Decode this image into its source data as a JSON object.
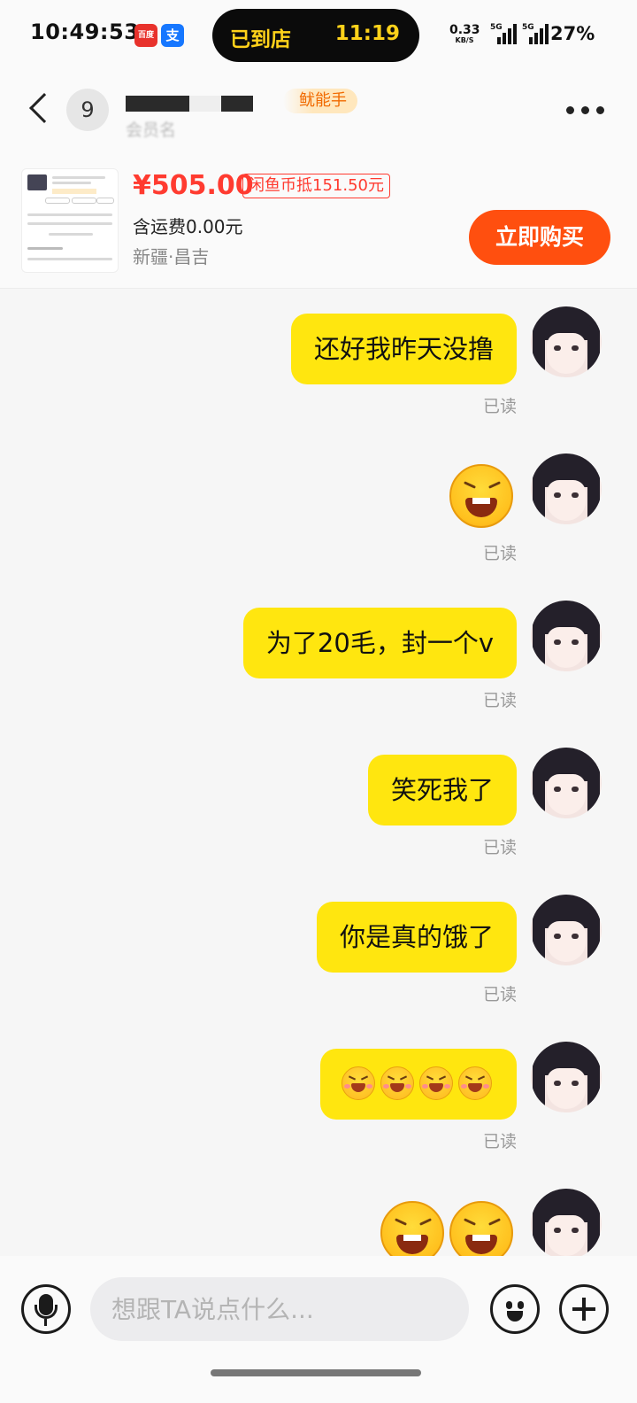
{
  "status_bar": {
    "time": "10:49:53",
    "app_badge_a": "百度",
    "app_badge_b": "支",
    "island_status": "已到店",
    "island_time": "11:19",
    "net_speed": "0.33",
    "net_unit": "KB/S",
    "signal_label": "5G",
    "battery": "27%"
  },
  "header": {
    "unread_count": "9",
    "seller_tag": "鱿能手",
    "member_line": "会员名"
  },
  "product": {
    "price": "¥505.00",
    "coin_deduct": "闲鱼币抵151.50元",
    "shipping": "含运费0.00元",
    "location": "新疆·昌吉",
    "buy_label": "立即购买"
  },
  "messages": [
    {
      "type": "text",
      "text": "还好我昨天没撸",
      "status": "已读"
    },
    {
      "type": "emoji",
      "emoji": "grinning-squint-emoji",
      "status": "已读"
    },
    {
      "type": "text",
      "text": "为了20毛，封一个v",
      "status": "已读"
    },
    {
      "type": "text",
      "text": "笑死我了",
      "status": "已读"
    },
    {
      "type": "text",
      "text": "你是真的饿了",
      "status": "已读"
    },
    {
      "type": "emoji-row",
      "emoji": "laughing-emoji",
      "count": 4,
      "status": "已读"
    },
    {
      "type": "emoji-pair",
      "emoji": "grinning-squint-emoji",
      "count": 2
    }
  ],
  "input": {
    "placeholder": "想跟TA说点什么..."
  },
  "colors": {
    "bubble": "#ffe60f",
    "price": "#ff3b30",
    "buy_button": "#ff4f0f",
    "island_text": "#ffd21a"
  }
}
